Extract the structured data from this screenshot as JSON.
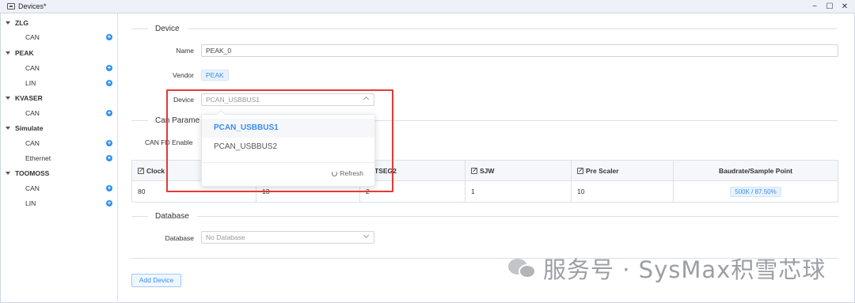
{
  "window": {
    "title": "Devices*",
    "controls": [
      "−",
      "☐",
      "✕"
    ]
  },
  "sidebar": {
    "groups": [
      {
        "label": "ZLG",
        "items": [
          {
            "label": "CAN"
          }
        ]
      },
      {
        "label": "PEAK",
        "items": [
          {
            "label": "CAN"
          },
          {
            "label": "LIN"
          }
        ]
      },
      {
        "label": "KVASER",
        "items": [
          {
            "label": "CAN"
          }
        ]
      },
      {
        "label": "Simulate",
        "items": [
          {
            "label": "CAN"
          },
          {
            "label": "Ethernet"
          }
        ]
      },
      {
        "label": "TOOMOSS",
        "items": [
          {
            "label": "CAN"
          },
          {
            "label": "LIN"
          }
        ]
      }
    ],
    "add_symbol": "+"
  },
  "device_section": {
    "title": "Device",
    "name_label": "Name",
    "name_value": "PEAK_0",
    "vendor_label": "Vendor",
    "vendor_value": "PEAK",
    "device_label": "Device",
    "device_value": "PCAN_USBBUS1"
  },
  "can_section": {
    "title": "Can Parame",
    "canfd_label": "CAN FD Enable",
    "table": {
      "headers": [
        "Clock",
        "",
        "TSEG2",
        "SJW",
        "Pre Scaler",
        "Baudrate/Sample Point"
      ],
      "row": [
        "80",
        "13",
        "2",
        "1",
        "10",
        "500K / 87.50%"
      ]
    }
  },
  "database_section": {
    "title": "Database",
    "label": "Database",
    "placeholder": "No Database"
  },
  "add_device_label": "Add Device",
  "dropdown": {
    "options": [
      "PCAN_USBBUS1",
      "PCAN_USBBUS2"
    ],
    "selected_index": 0,
    "refresh_label": "Refresh"
  },
  "watermark": "服务号 · SysMax积雪芯球",
  "colors": {
    "accent": "#3b8ef0",
    "highlight": "#e53935"
  }
}
